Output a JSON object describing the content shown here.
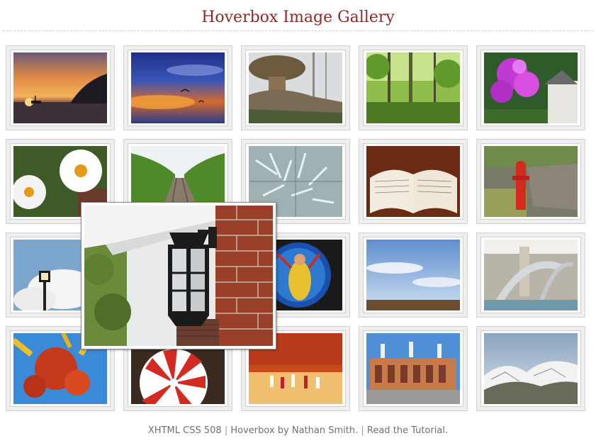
{
  "page": {
    "title": "Hoverbox Image Gallery"
  },
  "footer": {
    "xhtml": "XHTML",
    "css": "CSS",
    "section508": "508",
    "separator": "|",
    "credit": "Hoverbox by Nathan Smith.",
    "tutorial": "Read the Tutorial."
  },
  "gallery": {
    "thumbnails": [
      {
        "subject": "sunset-over-sea"
      },
      {
        "subject": "dramatic-sunset-sky-birds"
      },
      {
        "subject": "rock-formation-woods"
      },
      {
        "subject": "forest-trees"
      },
      {
        "subject": "hanging-flower-basket"
      },
      {
        "subject": "white-daisies"
      },
      {
        "subject": "railroad-tracks-trees"
      },
      {
        "subject": "frosted-pine-branches"
      },
      {
        "subject": "open-bible"
      },
      {
        "subject": "red-fire-hydrant"
      },
      {
        "subject": "lamp-post-clouds"
      },
      {
        "subject": "porch-lantern"
      },
      {
        "subject": "stained-glass-window"
      },
      {
        "subject": "open-field-sky"
      },
      {
        "subject": "fountain-sculpture"
      },
      {
        "subject": "red-berries-yellow-leaves"
      },
      {
        "subject": "red-white-ornament"
      },
      {
        "subject": "basketball-game"
      },
      {
        "subject": "stadium-exterior"
      },
      {
        "subject": "snowy-hills"
      }
    ],
    "enlarged": {
      "subject": "porch-lantern"
    }
  }
}
